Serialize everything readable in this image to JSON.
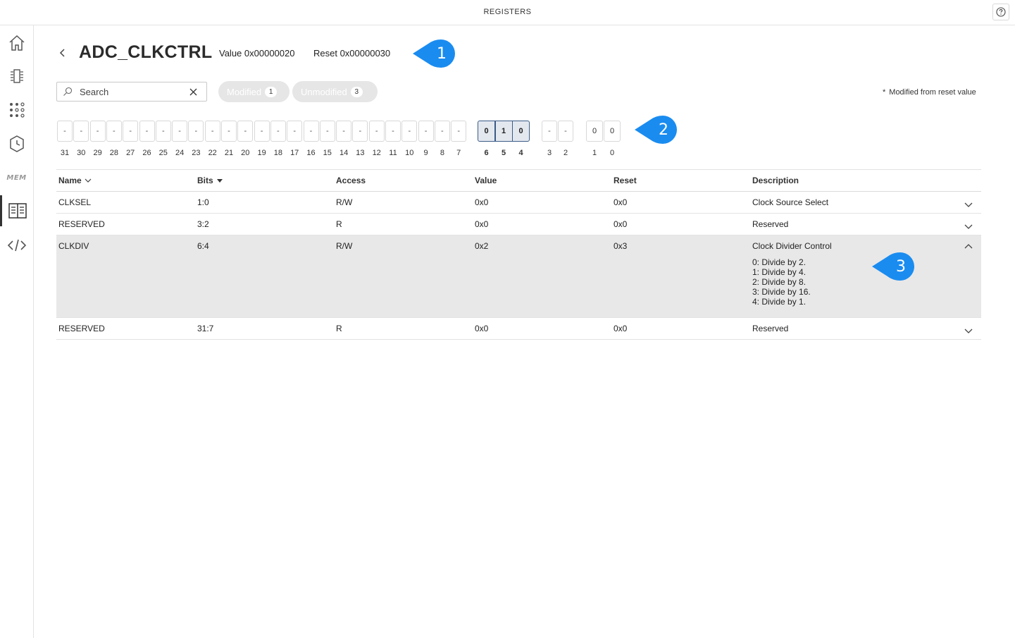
{
  "app": {
    "title": "REGISTERS"
  },
  "sidebar": {
    "items": [
      {
        "name": "home-icon"
      },
      {
        "name": "peripherals-icon"
      },
      {
        "name": "pins-icon"
      },
      {
        "name": "clock-icon"
      },
      {
        "name": "memory-icon",
        "label": "MEM"
      },
      {
        "name": "registers-book-icon",
        "active": true
      },
      {
        "name": "code-icon"
      }
    ]
  },
  "register": {
    "name": "ADC_CLKCTRL",
    "value_label": "Value 0x00000020",
    "reset_label": "Reset 0x00000030"
  },
  "callouts": [
    "1",
    "2",
    "3"
  ],
  "filters": {
    "search_placeholder": "Search",
    "modified_label": "Modified",
    "modified_count": "1",
    "unmodified_label": "Unmodified",
    "unmodified_count": "3",
    "legend_star": "*",
    "legend_text": "Modified from reset value"
  },
  "bits": {
    "reserved_high": {
      "numbers": [
        "31",
        "30",
        "29",
        "28",
        "27",
        "26",
        "25",
        "24",
        "23",
        "22",
        "21",
        "20",
        "19",
        "18",
        "17",
        "16",
        "15",
        "14",
        "13",
        "12",
        "11",
        "10",
        "9",
        "8",
        "7"
      ],
      "value": "-"
    },
    "clkdiv": {
      "numbers": [
        "6",
        "5",
        "4"
      ],
      "values": [
        "0",
        "1",
        "0"
      ]
    },
    "reserved_low": {
      "numbers": [
        "3",
        "2"
      ],
      "values": [
        "-",
        "-"
      ]
    },
    "clksel": {
      "numbers": [
        "1",
        "0"
      ],
      "values": [
        "0",
        "0"
      ]
    }
  },
  "table": {
    "headers": {
      "name": "Name",
      "bits": "Bits",
      "access": "Access",
      "value": "Value",
      "reset": "Reset",
      "description": "Description"
    },
    "rows": [
      {
        "name": "CLKSEL",
        "bits": "1:0",
        "access": "R/W",
        "value": "0x0",
        "reset": "0x0",
        "description": "Clock Source Select"
      },
      {
        "name": "RESERVED",
        "bits": "3:2",
        "access": "R",
        "value": "0x0",
        "reset": "0x0",
        "description": "Reserved"
      },
      {
        "name": "CLKDIV",
        "bits": "6:4",
        "access": "R/W",
        "value": "0x2",
        "reset": "0x3",
        "description": "Clock Divider Control",
        "details": [
          "0: Divide by 2.",
          "1: Divide by 4.",
          "2: Divide by 8.",
          "3: Divide by 16.",
          "4: Divide by 1."
        ]
      },
      {
        "name": "RESERVED",
        "bits": "31:7",
        "access": "R",
        "value": "0x0",
        "reset": "0x0",
        "description": "Reserved"
      }
    ]
  },
  "colors": {
    "callout": "#1a8cf0",
    "highlight_border": "#3a5b86",
    "expanded_row": "#e8e8e8"
  }
}
